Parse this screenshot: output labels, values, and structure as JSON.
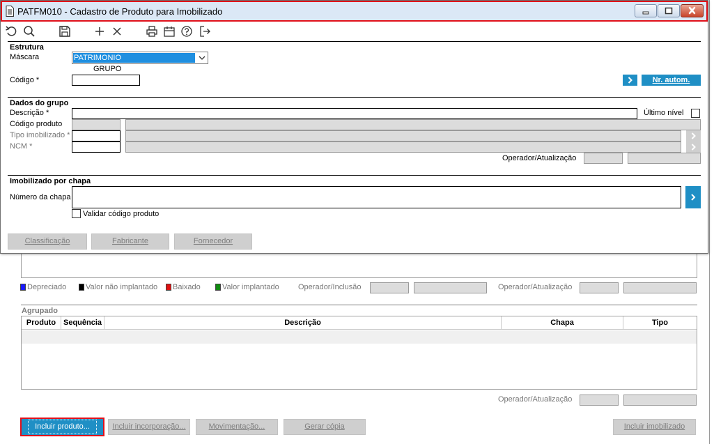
{
  "window": {
    "title": "PATFM010 - Cadastro de Produto para Imobilizado",
    "colors": {
      "accent": "#1f8fc5",
      "title_bg": "#dbe8f6",
      "highlight_red": "#e0101a"
    }
  },
  "toolbar": {
    "icons": [
      "undo-icon",
      "search-icon",
      "save-icon",
      "add-icon",
      "delete-icon",
      "print-icon",
      "calendar-icon",
      "help-icon",
      "exit-icon"
    ]
  },
  "estrutura": {
    "title": "Estrutura",
    "mascara_label": "Máscara",
    "mascara_value": "PATRIMONIO",
    "dropdown_option": "GRUPO",
    "codigo_label": "Código *",
    "nr_autom_label": "Nr. autom."
  },
  "dados_grupo": {
    "title": "Dados do grupo",
    "descricao_label": "Descrição *",
    "ultimo_nivel_label": "Último nível",
    "codigo_produto_label": "Código produto",
    "tipo_imobilizado_label": "Tipo imobilizado *",
    "ncm_label": "NCM *",
    "operador_label": "Operador/Atualização"
  },
  "imobilizado_chapa": {
    "title": "Imobilizado por chapa",
    "numero_label": "Número da chapa",
    "validar_label": "Validar código produto"
  },
  "dialog_buttons": {
    "classificacao": "Classificação",
    "fabricante": "Fabricante",
    "fornecedor": "Fornecedor"
  },
  "legend": {
    "depreciado": "Depreciado",
    "valor_nao_implantado": "Valor não implantado",
    "baixado": "Baixado",
    "valor_implantado": "Valor implantado",
    "operador_inclusao": "Operador/Inclusão",
    "operador_atualizacao": "Operador/Atualização",
    "colors": {
      "depreciado": "#1a1aff",
      "valor_nao_implantado": "#000000",
      "baixado": "#e01010",
      "valor_implantado": "#108a10"
    }
  },
  "agrupado": {
    "title": "Agrupado",
    "columns": [
      "Produto",
      "Sequência",
      "Descrição",
      "Chapa",
      "Tipo"
    ],
    "operador_label": "Operador/Atualização"
  },
  "bottom_buttons": {
    "incluir_produto": "Incluir produto...",
    "incluir_incorporacao": "Incluir incorporação...",
    "movimentacao": "Movimentação...",
    "gerar_copia": "Gerar cópia",
    "incluir_imobilizado": "Incluir imobilizado"
  }
}
